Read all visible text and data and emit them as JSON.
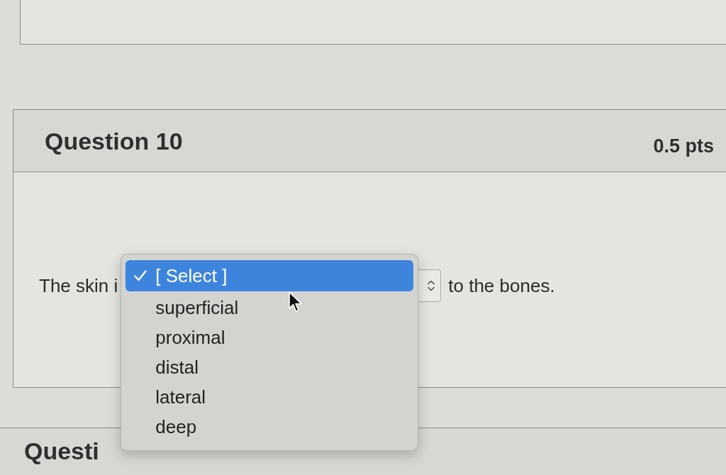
{
  "question": {
    "title": "Question 10",
    "points": "0.5 pts",
    "text_before": "The skin i",
    "text_after": "to the bones.",
    "dropdown": {
      "expanded": true,
      "options": [
        {
          "label": "[ Select ]",
          "selected": true
        },
        {
          "label": "superficial",
          "selected": false
        },
        {
          "label": "proximal",
          "selected": false
        },
        {
          "label": "distal",
          "selected": false
        },
        {
          "label": "lateral",
          "selected": false
        },
        {
          "label": "deep",
          "selected": false
        }
      ]
    }
  },
  "next_question": {
    "title": "Questi"
  }
}
